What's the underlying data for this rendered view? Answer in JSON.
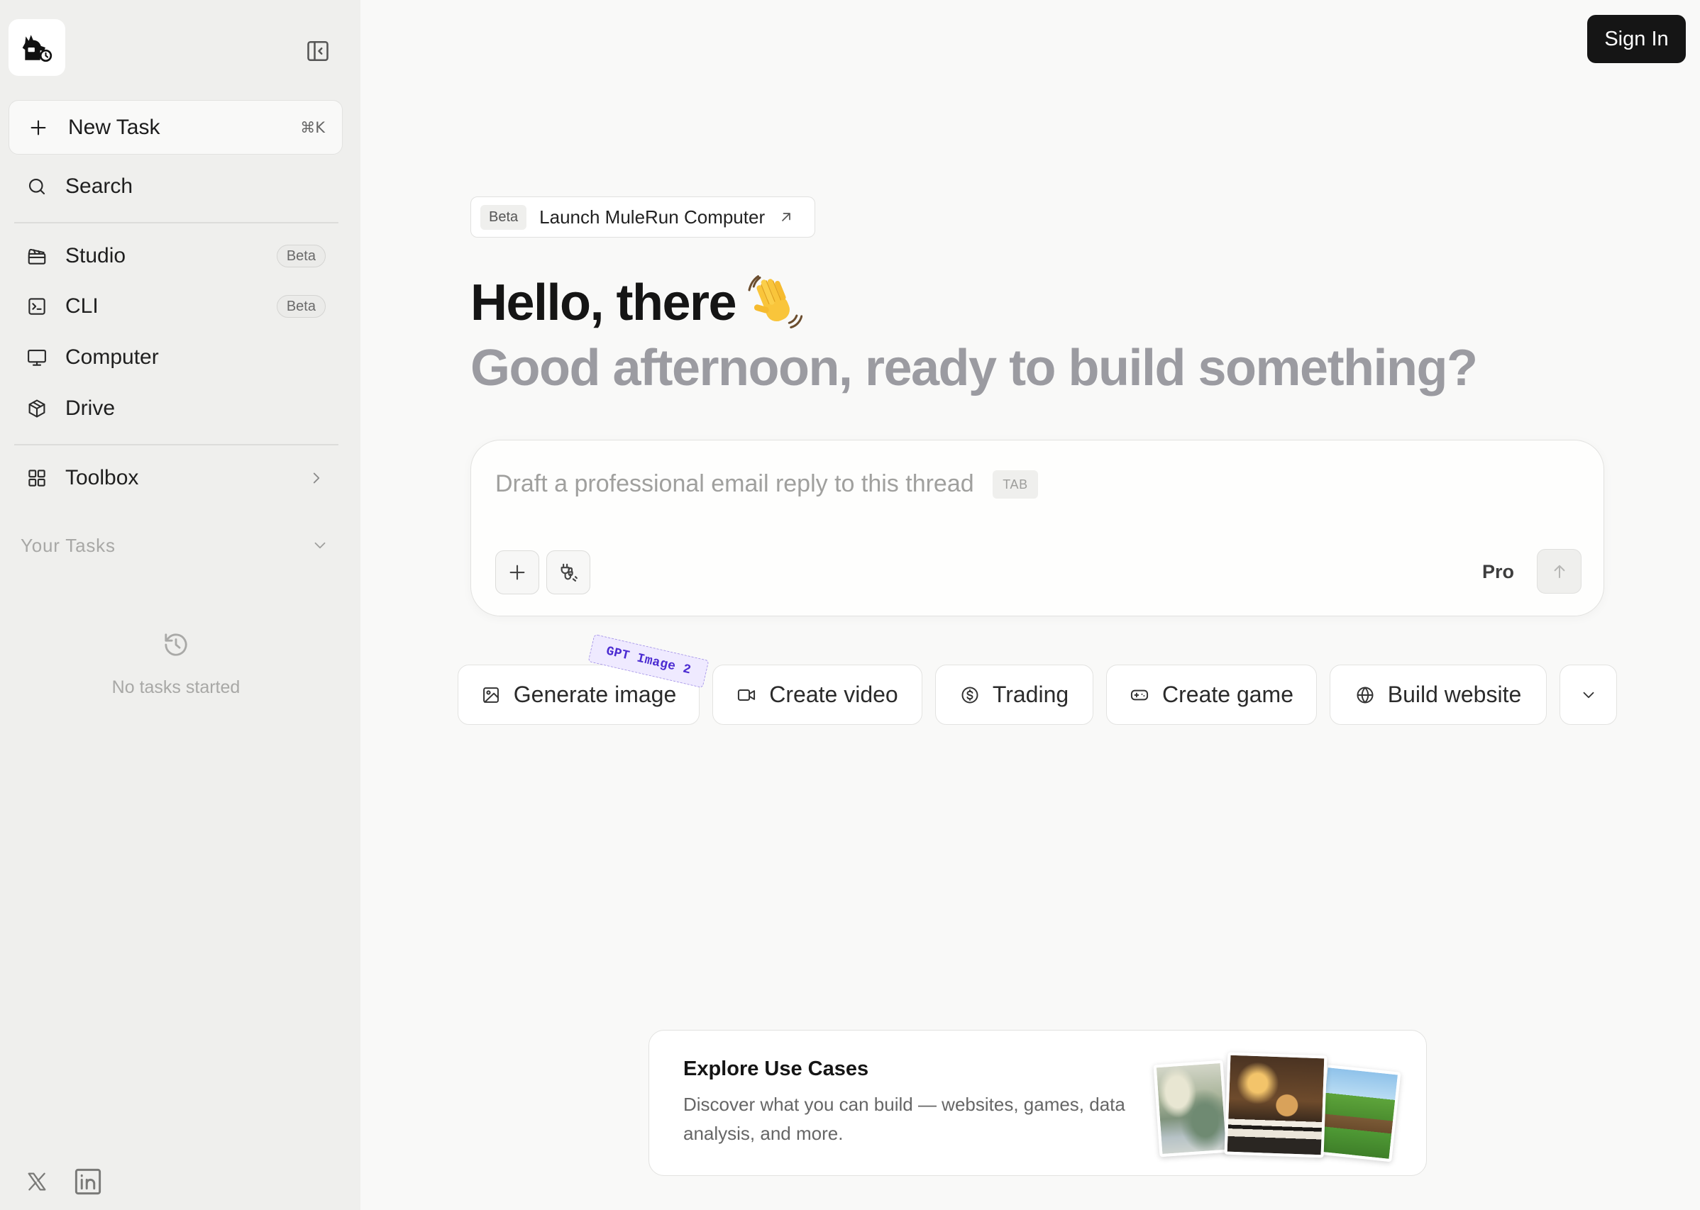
{
  "sidebar": {
    "logo_icon": "mulerun-logo-icon",
    "collapse_icon": "sidebar-collapse-icon",
    "new_task": {
      "label": "New Task",
      "shortcut": "⌘K",
      "icon": "plus-icon"
    },
    "search": {
      "label": "Search",
      "icon": "search-icon"
    },
    "nav": [
      {
        "label": "Studio",
        "badge": "Beta",
        "icon": "clapperboard-icon"
      },
      {
        "label": "CLI",
        "badge": "Beta",
        "icon": "terminal-icon"
      },
      {
        "label": "Computer",
        "icon": "monitor-icon"
      },
      {
        "label": "Drive",
        "icon": "package-icon"
      }
    ],
    "toolbox": {
      "label": "Toolbox",
      "icon": "grid-icon"
    },
    "tasks": {
      "heading": "Your Tasks",
      "empty_text": "No tasks started",
      "empty_icon": "history-icon"
    },
    "social_icons": [
      "x-logo-icon",
      "linkedin-icon"
    ]
  },
  "header": {
    "sign_in_label": "Sign In"
  },
  "hero": {
    "badge": "Beta",
    "launch_label": "Launch MuleRun Computer",
    "launch_icon": "arrow-up-right-icon",
    "greeting": "Hello, there",
    "greeting_icon": "waving-hand-icon",
    "subtitle": "Good afternoon, ready to build something?"
  },
  "composer": {
    "value": "",
    "placeholder": "Draft a professional email reply to this thread",
    "tab_hint": "TAB",
    "model_label": "Pro",
    "attach_icon": "plus-icon",
    "tools_icon": "connector-icon",
    "send_icon": "arrow-up-icon"
  },
  "quick_actions": {
    "items": [
      {
        "label": "Generate image",
        "icon": "image-icon",
        "tag": "GPT Image 2"
      },
      {
        "label": "Create video",
        "icon": "video-icon"
      },
      {
        "label": "Trading",
        "icon": "dollar-circle-icon"
      },
      {
        "label": "Create game",
        "icon": "gamepad-icon"
      },
      {
        "label": "Build website",
        "icon": "globe-icon"
      }
    ],
    "more_icon": "chevron-down-icon"
  },
  "explore": {
    "title": "Explore Use Cases",
    "description": "Discover what you can build — websites, games, data analysis, and more.",
    "thumbnail_icons": [
      "landscape-painting-image",
      "cat-piano-image",
      "voxel-landscape-image"
    ]
  },
  "colors": {
    "page_bg": "#f9f9f8",
    "sidebar_bg": "#efefed",
    "primary_button": "#151515",
    "subtitle_gray": "#9b9ba1",
    "tag_purple": "#4b2bd1"
  }
}
